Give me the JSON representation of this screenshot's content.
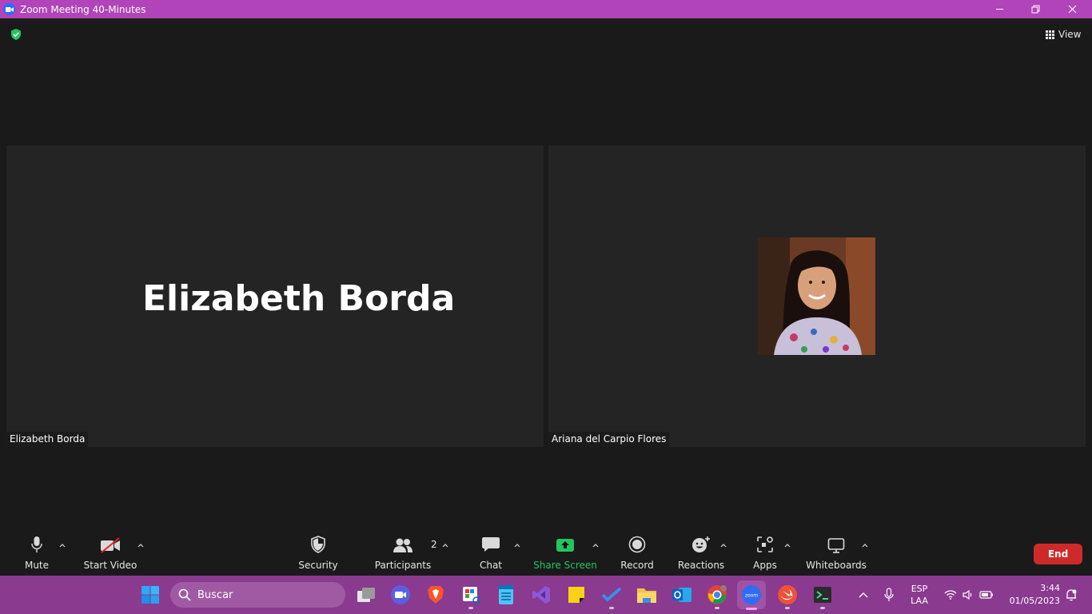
{
  "window": {
    "title": "Zoom Meeting 40-Minutes",
    "app_icon": "zoom-app-icon",
    "controls": [
      "minimize-icon",
      "maximize-icon",
      "close-icon"
    ]
  },
  "top_bar": {
    "security_icon": "shield-check-icon",
    "view_label": "View"
  },
  "participants": [
    {
      "name": "Elizabeth Borda",
      "display_name": "Elizabeth Borda",
      "video": "off"
    },
    {
      "name": "Ariana del Carpio Flores",
      "video": "photo"
    }
  ],
  "toolbar": {
    "items": [
      {
        "id": "mute",
        "label": "Mute",
        "icon": "microphone-icon",
        "caret": true
      },
      {
        "id": "start_video",
        "label": "Start Video",
        "icon": "video-off-icon",
        "caret": true
      },
      {
        "id": "security",
        "label": "Security",
        "icon": "shield-icon",
        "caret": false
      },
      {
        "id": "participants",
        "label": "Participants",
        "icon": "participants-icon",
        "count": "2",
        "caret": true
      },
      {
        "id": "chat",
        "label": "Chat",
        "icon": "chat-icon",
        "caret": true
      },
      {
        "id": "share_screen",
        "label": "Share Screen",
        "icon": "share-screen-icon",
        "caret": true
      },
      {
        "id": "record",
        "label": "Record",
        "icon": "record-icon",
        "caret": false
      },
      {
        "id": "reactions",
        "label": "Reactions",
        "icon": "reactions-icon",
        "caret": true
      },
      {
        "id": "apps",
        "label": "Apps",
        "icon": "apps-icon",
        "caret": true
      },
      {
        "id": "whiteboards",
        "label": "Whiteboards",
        "icon": "whiteboard-icon",
        "caret": true
      }
    ],
    "end_label": "End",
    "accent_share": "#22c55e",
    "end_color": "#cf2a2a"
  },
  "taskbar": {
    "search_placeholder": "Buscar",
    "apps": [
      "windows-start-icon",
      "task-view-icon",
      "meet-icon",
      "brave-icon",
      "snipping-tool-icon",
      "notepad-icon",
      "visual-studio-icon",
      "sticky-notes-icon",
      "todo-icon",
      "file-explorer-icon",
      "outlook-icon",
      "chrome-icon",
      "zoom-icon",
      "swift-icon",
      "terminal-icon"
    ],
    "language_top": "ESP",
    "language_bottom": "LAA",
    "time": "3:44",
    "date": "01/05/2023",
    "color": "#8a3a8f"
  },
  "colors": {
    "titlebar": "#b044b8",
    "background": "#1a1a1a",
    "tile": "#242424"
  }
}
